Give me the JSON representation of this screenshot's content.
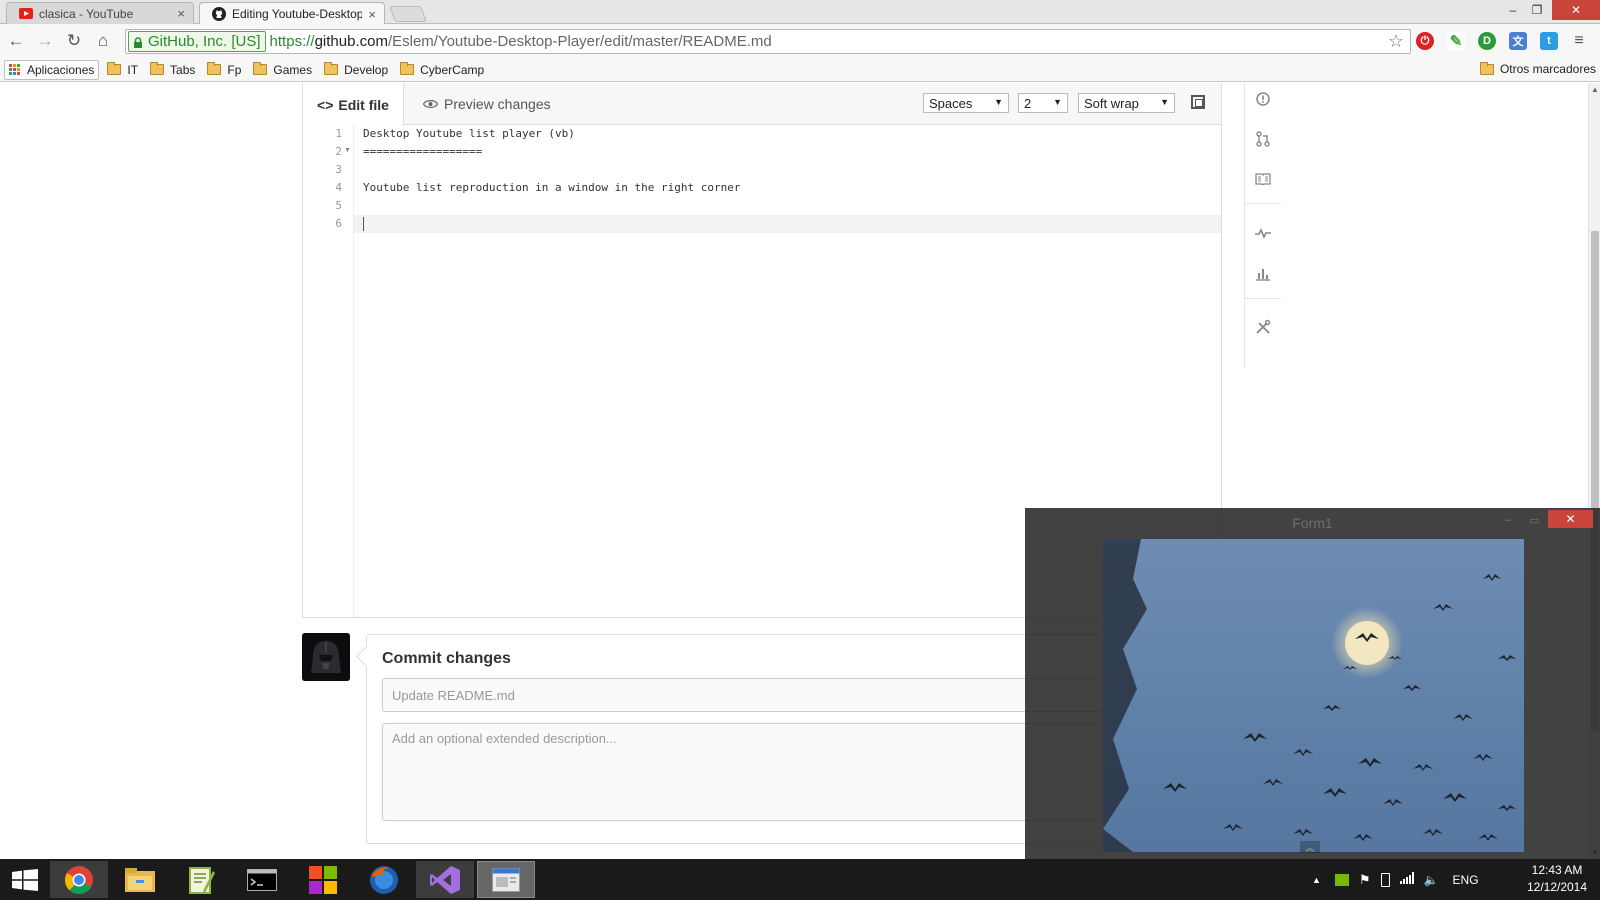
{
  "browser": {
    "tabs": [
      {
        "title": "clasica - YouTube",
        "close": "×"
      },
      {
        "title": "Editing Youtube-Desktop-",
        "close": "×"
      }
    ],
    "window_controls": {
      "minimize": "–",
      "restore": "❐",
      "close": "✕"
    },
    "nav": {
      "back": "←",
      "forward": "→",
      "reload": "↻",
      "home": "⌂"
    },
    "security_label": "GitHub, Inc. [US]",
    "url": {
      "scheme": "https://",
      "host": "github.com",
      "path": "/Eslem/Youtube-Desktop-Player/edit/master/README.md"
    },
    "extensions": [
      "star-icon",
      "stop-extension-icon",
      "eyedropper-icon",
      "ide-extension-icon",
      "translate-icon",
      "twitter-icon",
      "menu-icon"
    ],
    "bookmarks": {
      "apps": "Aplicaciones",
      "folders": [
        "IT",
        "Tabs",
        "Fp",
        "Games",
        "Develop",
        "CyberCamp"
      ],
      "other": "Otros marcadores"
    }
  },
  "editor": {
    "tab_edit": "Edit file",
    "tab_preview": "Preview changes",
    "indent_mode": "Spaces",
    "indent_size": "2",
    "wrap_mode": "Soft wrap",
    "lines": [
      {
        "num": "1",
        "text": "Desktop Youtube list player (vb)"
      },
      {
        "num": "2",
        "text": "=================="
      },
      {
        "num": "3",
        "text": ""
      },
      {
        "num": "4",
        "text": "Youtube list reproduction in a window in the right corner"
      },
      {
        "num": "5",
        "text": ""
      },
      {
        "num": "6",
        "text": ""
      }
    ]
  },
  "commit": {
    "heading": "Commit changes",
    "summary_placeholder": "Update README.md",
    "description_placeholder": "Add an optional extended description..."
  },
  "form1": {
    "title": "Form1",
    "minimize": "–",
    "maximize": "▭",
    "close": "✕"
  },
  "taskbar": {
    "language": "ENG",
    "time": "12:43 AM",
    "date": "12/12/2014"
  },
  "colors": {
    "accent_green": "#60b044",
    "close_red": "#c9443a",
    "taskbar": "#1a1a1a"
  }
}
